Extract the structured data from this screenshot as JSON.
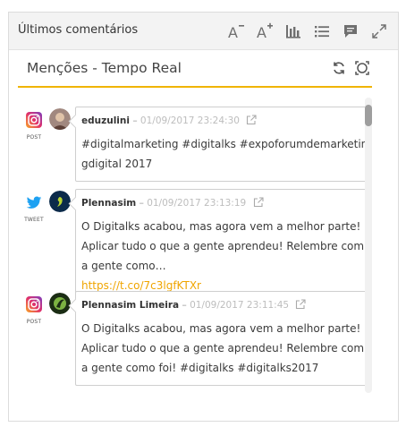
{
  "widget": {
    "title": "Últimos comentários",
    "tools": [
      "font-decrease-icon",
      "font-increase-icon",
      "bar-chart-icon",
      "list-icon",
      "comment-icon",
      "expand-icon"
    ]
  },
  "panel": {
    "title": "Menções - Tempo Real",
    "tools": [
      "refresh-icon",
      "fullscreen-icon"
    ],
    "accent_color": "#f0b400"
  },
  "posts": [
    {
      "network": "instagram",
      "network_label": "POST",
      "author": "eduzulini",
      "separator": "–",
      "date": "01/09/2017 23:24:30",
      "text": "#digitalmarketing #digitalks #expoforumdemarketingdigital 2017",
      "link": ""
    },
    {
      "network": "twitter",
      "network_label": "TWEET",
      "author": "Plennasim",
      "separator": "–",
      "date": "01/09/2017 23:13:19",
      "text": "O Digitalks acabou, mas agora vem a melhor parte! Aplicar tudo o que a gente aprendeu! Relembre com a gente como…",
      "link": "https://t.co/7c3lgfKTXr"
    },
    {
      "network": "instagram",
      "network_label": "POST",
      "author": "Plennasim Limeira",
      "separator": "–",
      "date": "01/09/2017 23:11:45",
      "text": "O Digitalks acabou, mas agora vem a melhor parte! Aplicar tudo o que a gente aprendeu! Relembre com a gente como foi! #digitalks #digitalks2017",
      "link": ""
    }
  ]
}
